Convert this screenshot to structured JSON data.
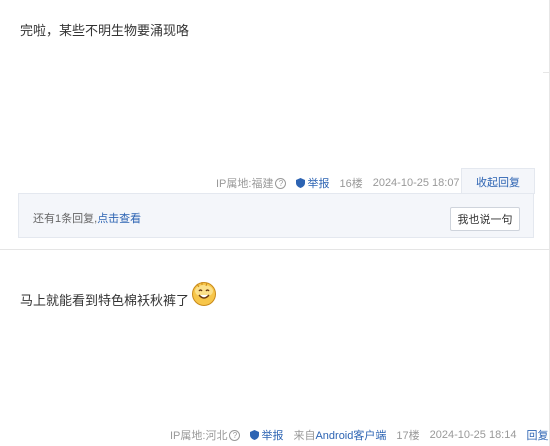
{
  "posts": [
    {
      "content": "完啦，某些不明生物要涌现咯",
      "ip_location": "IP属地:福建",
      "report_label": "举报",
      "floor": "16楼",
      "time": "2024-10-25 18:07",
      "collapse_label": "收起回复",
      "reply_summary_prefix": "还有1条回复,",
      "reply_summary_link": "点击查看",
      "say_button": "我也说一句"
    },
    {
      "content": "马上就能看到特色棉袄秋裤了",
      "emoji": "smiling-face-emoji",
      "ip_location": "IP属地:河北",
      "report_label": "举报",
      "client_prefix": "来自",
      "client_name": "Android客户端",
      "floor": "17楼",
      "time": "2024-10-25 18:14",
      "reply_label": "回复"
    }
  ],
  "colors": {
    "link": "#2d64b3",
    "meta": "#999999",
    "reply_bg": "#f4f6fa"
  }
}
